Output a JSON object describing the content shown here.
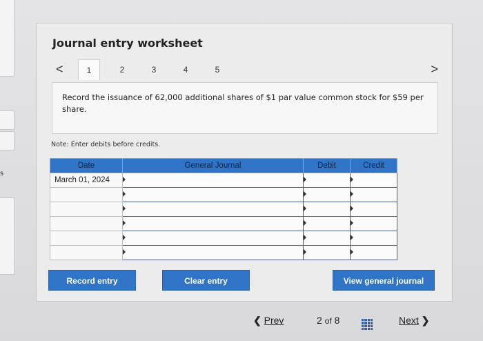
{
  "worksheet": {
    "title": "Journal entry worksheet",
    "tabs": [
      "1",
      "2",
      "3",
      "4",
      "5"
    ],
    "prev_tab_glyph": "<",
    "next_tab_glyph": ">",
    "prompt": "Record the issuance of 62,000 additional shares of $1 par value common stock for $59 per share.",
    "note": "Note: Enter debits before credits.",
    "table": {
      "headers": [
        "Date",
        "General Journal",
        "Debit",
        "Credit"
      ],
      "rows": [
        {
          "date": "March 01, 2024",
          "account": "",
          "debit": "",
          "credit": ""
        },
        {
          "date": "",
          "account": "",
          "debit": "",
          "credit": ""
        },
        {
          "date": "",
          "account": "",
          "debit": "",
          "credit": ""
        },
        {
          "date": "",
          "account": "",
          "debit": "",
          "credit": ""
        },
        {
          "date": "",
          "account": "",
          "debit": "",
          "credit": ""
        },
        {
          "date": "",
          "account": "",
          "debit": "",
          "credit": ""
        }
      ]
    },
    "buttons": {
      "record": "Record entry",
      "clear": "Clear entry",
      "view": "View general journal"
    }
  },
  "pagination": {
    "prev": "Prev",
    "current": "2",
    "of_label": "of",
    "total": "8",
    "next": "Next"
  },
  "side": {
    "fragment_text": "s"
  },
  "colors": {
    "accent": "#2f74c7"
  }
}
